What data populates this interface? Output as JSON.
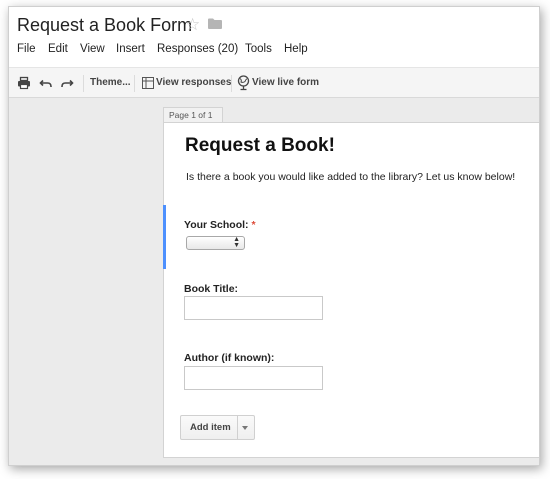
{
  "document": {
    "title": "Request a Book Form"
  },
  "menu": {
    "items": [
      "File",
      "Edit",
      "View",
      "Insert",
      "Responses (20)",
      "Tools",
      "Help"
    ]
  },
  "toolbar": {
    "theme_label": "Theme...",
    "view_responses_label": "View responses",
    "view_live_form_label": "View live form"
  },
  "page_tab": {
    "label": "Page 1 of 1"
  },
  "form": {
    "title": "Request a Book!",
    "description": "Is there a book you would like added to the library? Let us know below!",
    "questions": [
      {
        "label": "Your School:",
        "required_mark": "*"
      },
      {
        "label": "Book Title:"
      },
      {
        "label": "Author (if known):"
      }
    ]
  },
  "add_item": {
    "label": "Add item"
  },
  "colors": {
    "accent": "#4d90fe",
    "required": "#dd4b39"
  }
}
